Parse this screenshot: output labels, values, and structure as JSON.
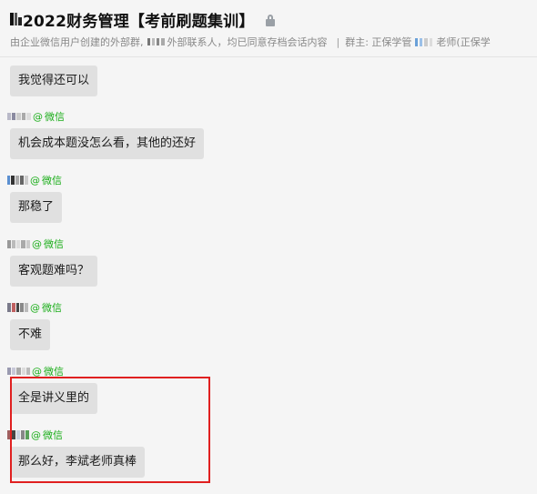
{
  "header": {
    "title": "2022财务管理【考前刷题集训】",
    "subtitle_main": "由企业微信用户创建的外部群,",
    "subtitle_mid": "外部联系人，均已同意存档会话内容",
    "subtitle_sep": "|",
    "subtitle_owner_prefix": "群主: 正保学管",
    "subtitle_owner_suffix": "老师(正保学"
  },
  "messages": [
    {
      "text": "我觉得还可以"
    },
    {
      "source": "微信",
      "text": "机会成本题没怎么看，其他的还好"
    },
    {
      "source": "微信",
      "text": "那稳了"
    },
    {
      "source": "微信",
      "text": "客观题难吗？"
    },
    {
      "source": "微信",
      "text": "不难"
    },
    {
      "source": "微信",
      "text": "全是讲义里的"
    },
    {
      "source": "微信",
      "text": "那么好，李斌老师真棒"
    }
  ],
  "colors": {
    "background": "#f5f5f5",
    "bubble": "#e0e0e0",
    "source_green": "#1aad19",
    "highlight_red": "#e02020"
  },
  "icons": {
    "lock": "lock-icon",
    "source": "wechat-source-at-icon"
  }
}
